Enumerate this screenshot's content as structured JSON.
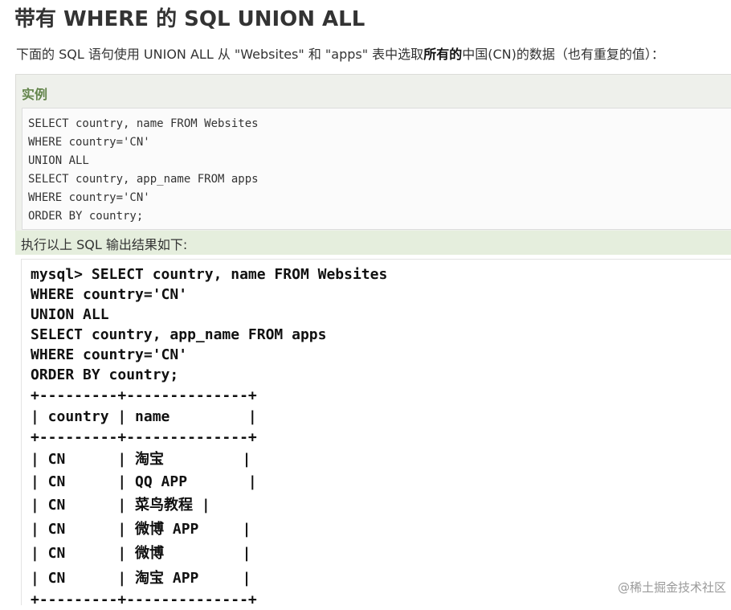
{
  "page": {
    "title": "带有 WHERE 的 SQL UNION ALL",
    "intro_prefix": "下面的 SQL 语句使用 UNION ALL 从 \"Websites\" 和 \"apps\" 表中选取",
    "intro_bold": "所有的",
    "intro_suffix": "中国(CN)的数据（也有重复的值）："
  },
  "example": {
    "label": "实例",
    "code_lines": [
      "SELECT country, name FROM Websites",
      "WHERE country='CN'",
      "UNION ALL",
      "SELECT country, app_name FROM apps",
      "WHERE country='CN'",
      "ORDER BY country;"
    ]
  },
  "result": {
    "caption": "执行以上 SQL 输出结果如下:",
    "terminal_lines": [
      "mysql> SELECT country, name FROM Websites",
      "WHERE country='CN'",
      "UNION ALL",
      "SELECT country, app_name FROM apps",
      "WHERE country='CN'",
      "ORDER BY country;",
      "+---------+--------------+",
      "| country | name         |",
      "+---------+--------------+",
      "| CN      | 淘宝         |",
      "| CN      | QQ APP       |",
      "| CN      | 菜鸟教程 |",
      "| CN      | 微博 APP     |",
      "| CN      | 微博         |",
      "| CN      | 淘宝 APP     |",
      "+---------+--------------+"
    ]
  },
  "watermark": "@稀土掘金技术社区"
}
